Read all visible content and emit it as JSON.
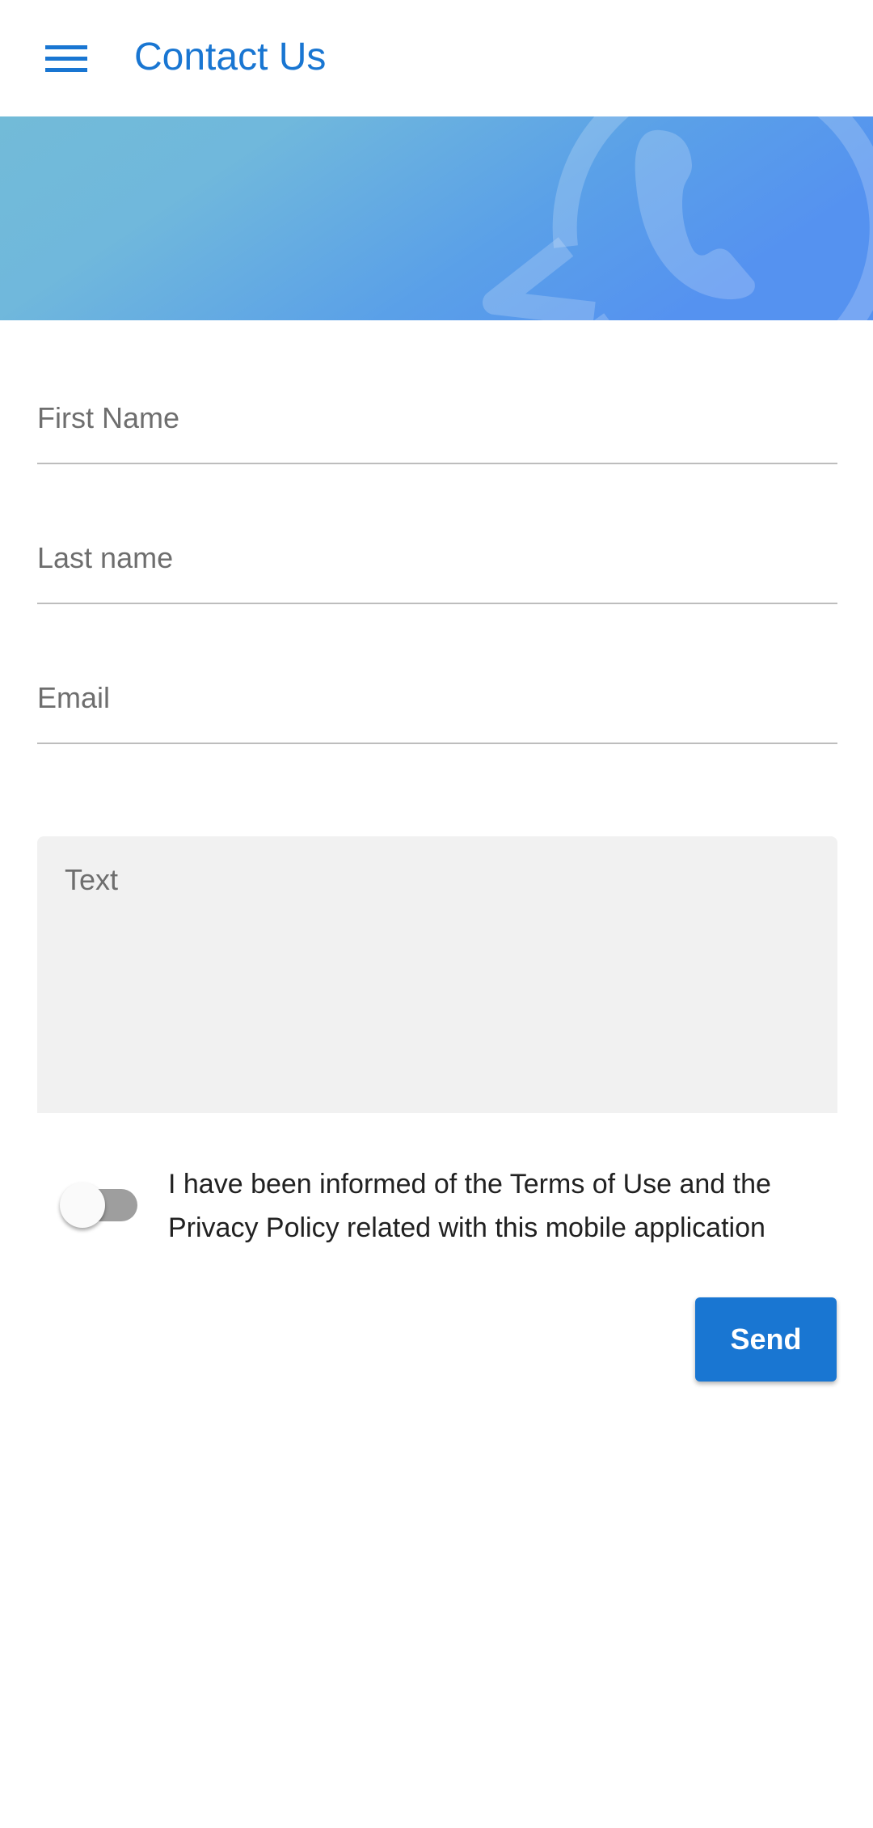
{
  "appbar": {
    "title": "Contact Us",
    "menu_icon": "hamburger-menu-icon",
    "title_color": "#1976d2"
  },
  "banner": {
    "icon": "chat-bubble-phone-icon",
    "gradient_start": "#72bbd8",
    "gradient_end": "#5896ee"
  },
  "form": {
    "first_name": {
      "placeholder": "First Name",
      "value": ""
    },
    "last_name": {
      "placeholder": "Last name",
      "value": ""
    },
    "email": {
      "placeholder": "Email",
      "value": ""
    },
    "text": {
      "placeholder": "Text",
      "value": ""
    },
    "consent": {
      "label": "I have been informed of the Terms of Use and the Privacy Policy related with this mobile application",
      "checked": false
    },
    "send_label": "Send"
  },
  "colors": {
    "accent": "#1976d2",
    "divider": "#bdbdbd",
    "textarea_bg": "#f1f1f1",
    "toggle_track_off": "#9e9e9e"
  }
}
